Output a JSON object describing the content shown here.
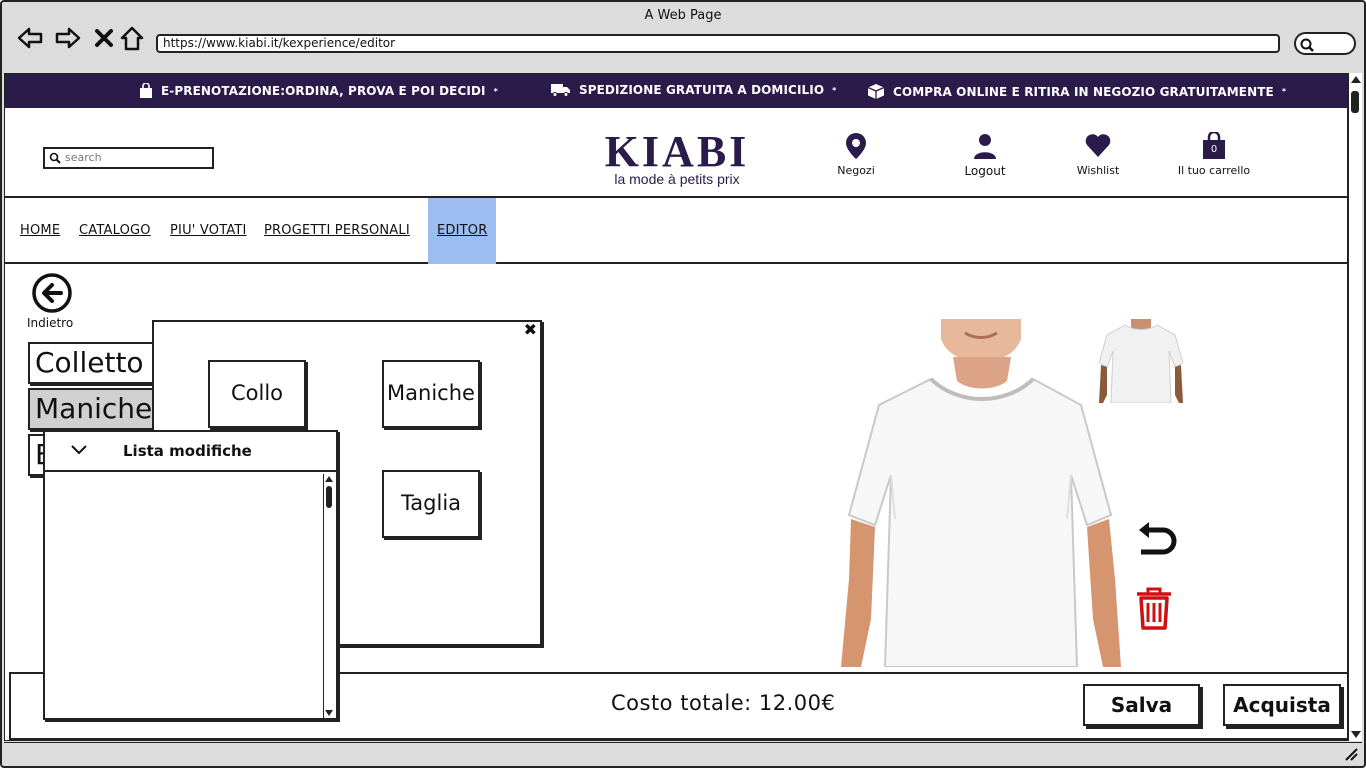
{
  "browser": {
    "window_title": "A Web Page",
    "url": "https://www.kiabi.it/kexperience/editor"
  },
  "promo": {
    "items": [
      {
        "icon": "shopping-bag-icon",
        "text": "E-PRENOTAZIONE:ORDINA, PROVA E POI DECIDI",
        "mark": "*"
      },
      {
        "icon": "truck-icon",
        "text": "SPEDIZIONE GRATUITA A DOMICILIO",
        "mark": "*"
      },
      {
        "icon": "box-icon",
        "text": "COMPRA ONLINE E RITIRA IN NEGOZIO GRATUITAMENTE",
        "mark": "*"
      }
    ]
  },
  "header": {
    "search_placeholder": "search",
    "logo_word": "KIABI",
    "logo_tagline": "la mode à petits prix",
    "actions": {
      "stores": "Negozi",
      "logout": "Logout",
      "wishlist": "Wishlist",
      "cart": "Il tuo carrello",
      "cart_count": "0"
    }
  },
  "nav": {
    "items": [
      "HOME",
      "CATALOGO",
      "PIU' VOTATI",
      "PROGETTI PERSONALI",
      "EDITOR"
    ],
    "active": "EDITOR",
    "active_color": "#9dbdf0"
  },
  "editor": {
    "back_label": "Indietro",
    "tabs": [
      "Colletto",
      "Maniche",
      "B"
    ],
    "selected_tab": "Maniche",
    "options": [
      "Collo",
      "Maniche",
      "Taglia"
    ],
    "changes_title": "Lista modifiche"
  },
  "footer": {
    "total": "Costo totale: 12.00€",
    "save": "Salva",
    "buy": "Acquista"
  },
  "colors": {
    "brand": "#2a1b4a",
    "trash": "#d01010"
  }
}
